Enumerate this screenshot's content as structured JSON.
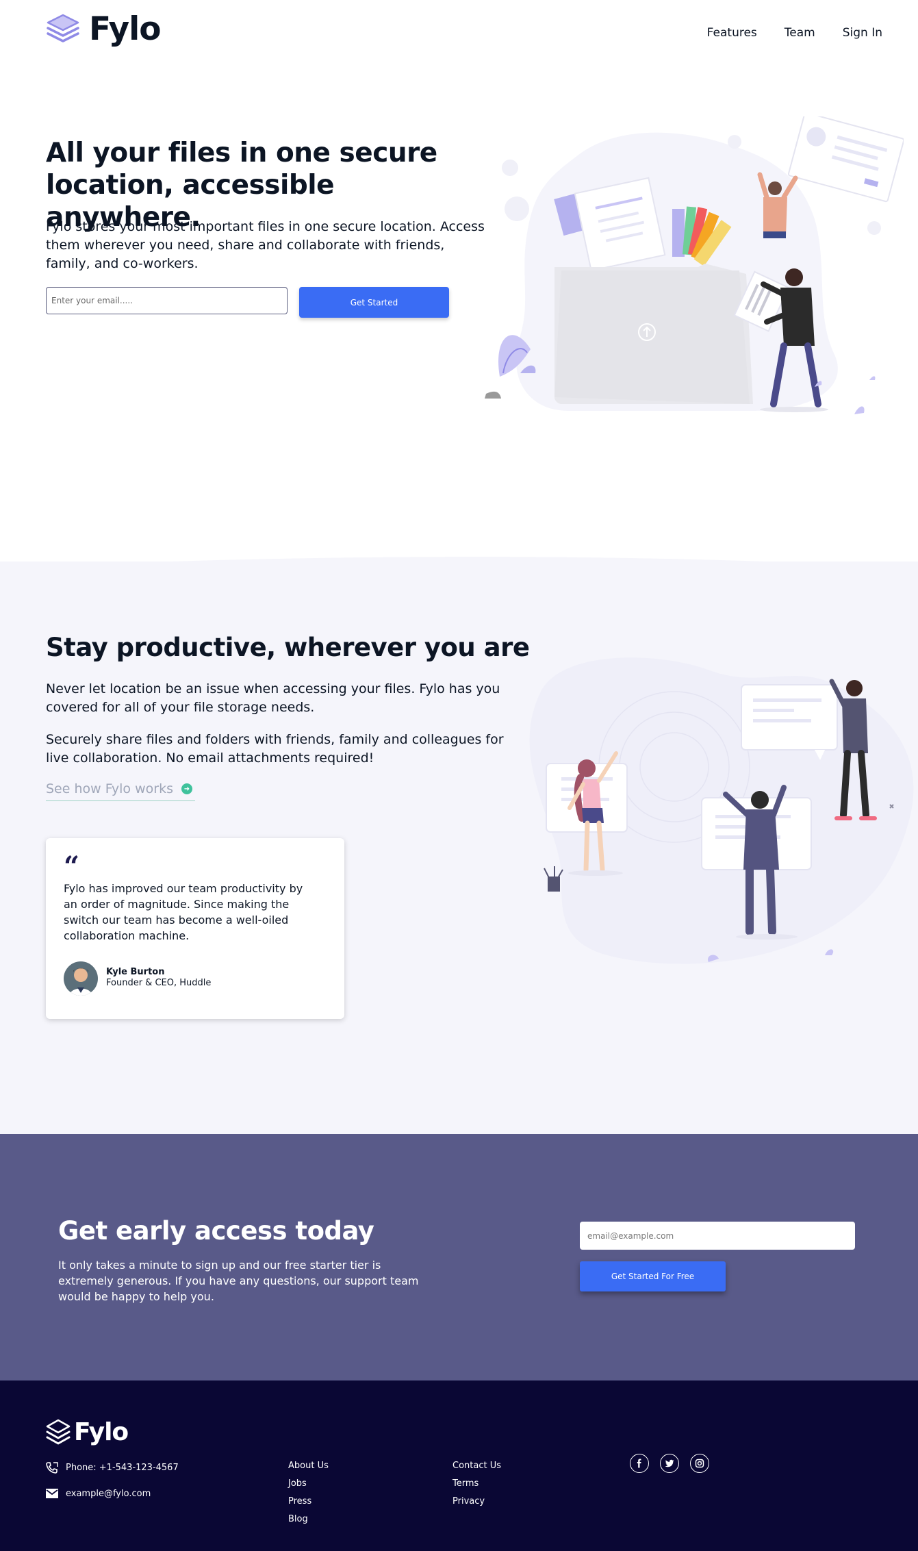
{
  "header": {
    "brand": "Fylo",
    "nav": [
      "Features",
      "Team",
      "Sign In"
    ]
  },
  "hero": {
    "title": "All your files in one secure location, accessible anywhere.",
    "description": "Fylo stores your most important files in one secure location. Access them wherever you need, share and collaborate with friends, family, and co-workers.",
    "email_placeholder": "Enter your email.....",
    "button_label": "Get Started"
  },
  "productive": {
    "title": "Stay productive, wherever you are",
    "paragraph1": "Never let location be an issue when accessing your files. Fylo has you covered for all of your file storage needs.",
    "paragraph2": "Securely share files and folders with friends, family and colleagues for live collaboration. No email attachments required!",
    "link_label": "See how Fylo works",
    "testimonial": {
      "quote": "Fylo has improved our team productivity by an order of magnitude. Since making the switch our team has become a well-oiled collaboration machine.",
      "name": "Kyle Burton",
      "role": "Founder & CEO, Huddle"
    }
  },
  "early_access": {
    "title": "Get early access today",
    "description": "It only takes a minute to sign up and our free starter tier is extremely generous. If you have any questions, our support team would be happy to help you.",
    "email_placeholder": "email@example.com",
    "button_label": "Get Started For Free"
  },
  "footer": {
    "brand": "Fylo",
    "phone": "Phone: +1-543-123-4567",
    "email": "example@fylo.com",
    "column1": [
      "About Us",
      "Jobs",
      "Press",
      "Blog"
    ],
    "column2": [
      "Contact Us",
      "Terms",
      "Privacy"
    ],
    "social": [
      "facebook-icon",
      "twitter-icon",
      "instagram-icon"
    ]
  },
  "colors": {
    "primary_button": "#3a6cf4",
    "early_access_bg": "#595a89",
    "footer_bg": "#0a0734",
    "section_bg": "#f5f5fb",
    "link_underline": "#9cd1c3",
    "arrow_accent": "#3fc29c"
  }
}
